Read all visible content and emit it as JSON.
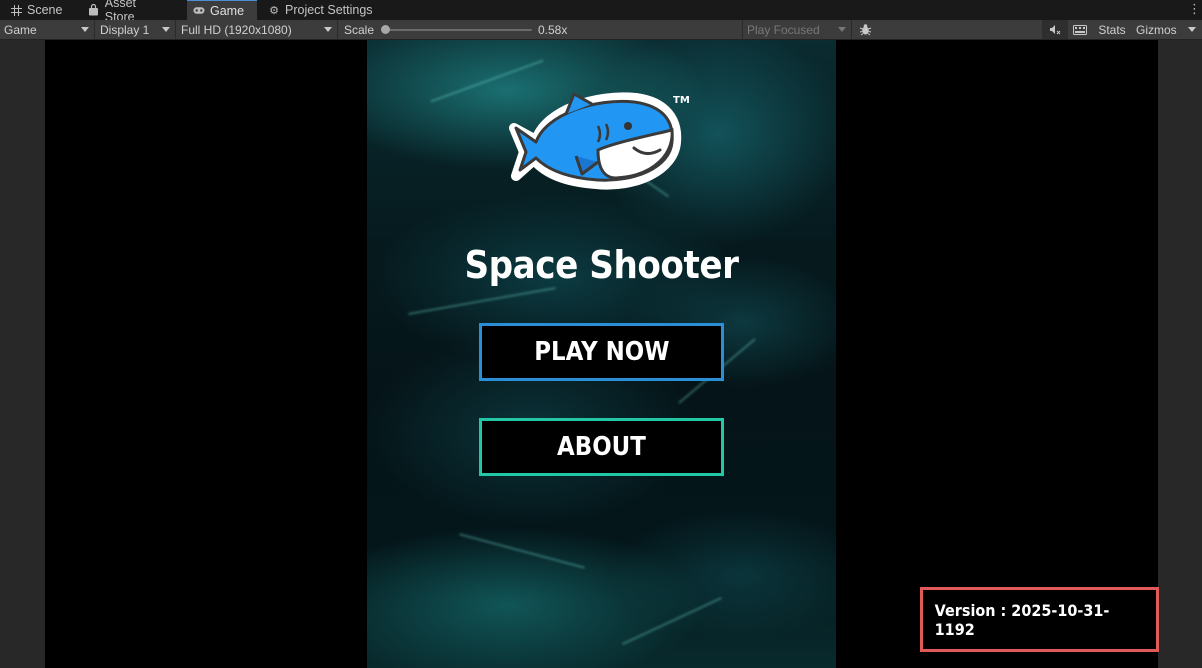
{
  "tabs": [
    {
      "label": "Scene",
      "icon": "grid-icon"
    },
    {
      "label": "Asset Store",
      "icon": "bag-icon"
    },
    {
      "label": "Game",
      "icon": "gamepad-icon"
    },
    {
      "label": "Project Settings",
      "icon": "gear-icon"
    }
  ],
  "toolbar": {
    "view_mode": "Game",
    "display": "Display 1",
    "resolution": "Full HD (1920x1080)",
    "scale_label": "Scale",
    "scale_value": "0.58x",
    "scale_level": 0.0,
    "play_mode": "Play Focused",
    "stats": "Stats",
    "gizmos": "Gizmos"
  },
  "game": {
    "title": "Space Shooter",
    "trademark": "TM",
    "play_button": "PLAY NOW",
    "about_button": "ABOUT",
    "version": "Version : 2025-10-31-1192"
  },
  "colors": {
    "play_border": "#2a8fd6",
    "about_border": "#22c7a6",
    "highlight": "#e05a5a",
    "shark_blue": "#2196f3"
  }
}
